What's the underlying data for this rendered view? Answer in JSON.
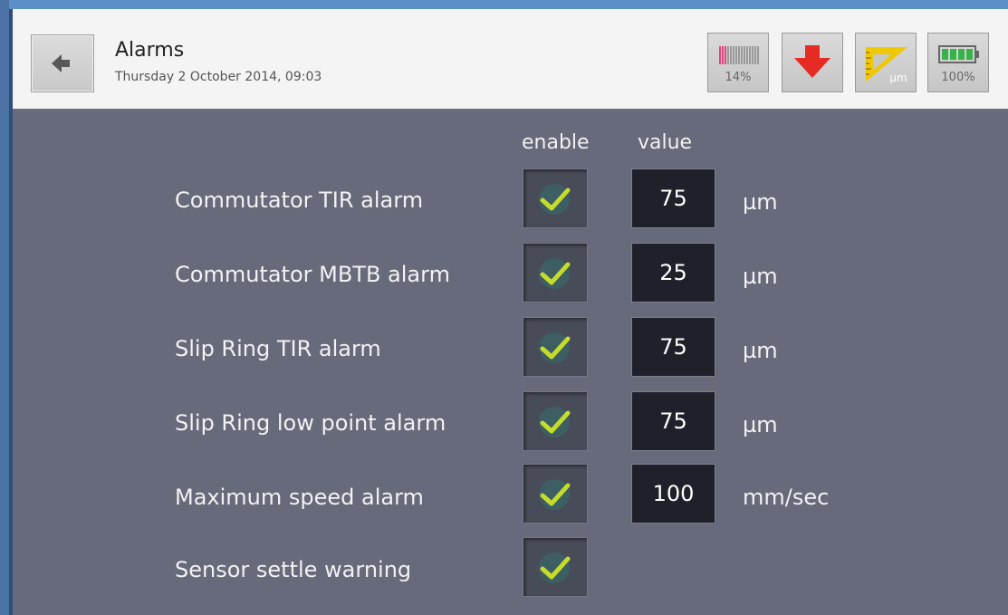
{
  "header": {
    "title": "Alarms",
    "date": "Thursday 2 October 2014, 09:03",
    "signal_label": "14%",
    "units_label": "µm",
    "battery_label": "100%"
  },
  "columns": {
    "enable": "enable",
    "value": "value"
  },
  "rows": [
    {
      "label": "Commutator TIR alarm",
      "enabled": true,
      "value": "75",
      "unit": "µm"
    },
    {
      "label": "Commutator MBTB alarm",
      "enabled": true,
      "value": "25",
      "unit": "µm"
    },
    {
      "label": "Slip Ring TIR alarm",
      "enabled": true,
      "value": "75",
      "unit": "µm"
    },
    {
      "label": "Slip Ring low point alarm",
      "enabled": true,
      "value": "75",
      "unit": "µm"
    },
    {
      "label": "Maximum speed alarm",
      "enabled": true,
      "value": "100",
      "unit": "mm/sec"
    },
    {
      "label": "Sensor settle warning",
      "enabled": true
    }
  ],
  "colors": {
    "background": "#666a7a",
    "check": "#c6dc2a",
    "down_arrow": "#e52b24",
    "battery": "#37b34a"
  },
  "icons": [
    "back-arrow-icon",
    "signal-strength-icon",
    "download-arrow-icon",
    "ruler-units-icon",
    "battery-icon",
    "checkmark-icon"
  ]
}
